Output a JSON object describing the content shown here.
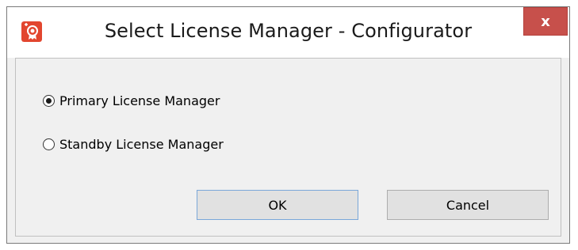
{
  "window": {
    "title": "Select License Manager - Configurator",
    "close_glyph": "x",
    "app_icon": "license-certificate-icon"
  },
  "options": [
    {
      "label": "Primary License Manager",
      "selected": true
    },
    {
      "label": "Standby License Manager",
      "selected": false
    }
  ],
  "buttons": {
    "ok_label": "OK",
    "cancel_label": "Cancel"
  },
  "colors": {
    "close_button": "#c7504b",
    "app_icon_bg": "#e2462f",
    "dialog_bg": "#f0f0f0"
  }
}
